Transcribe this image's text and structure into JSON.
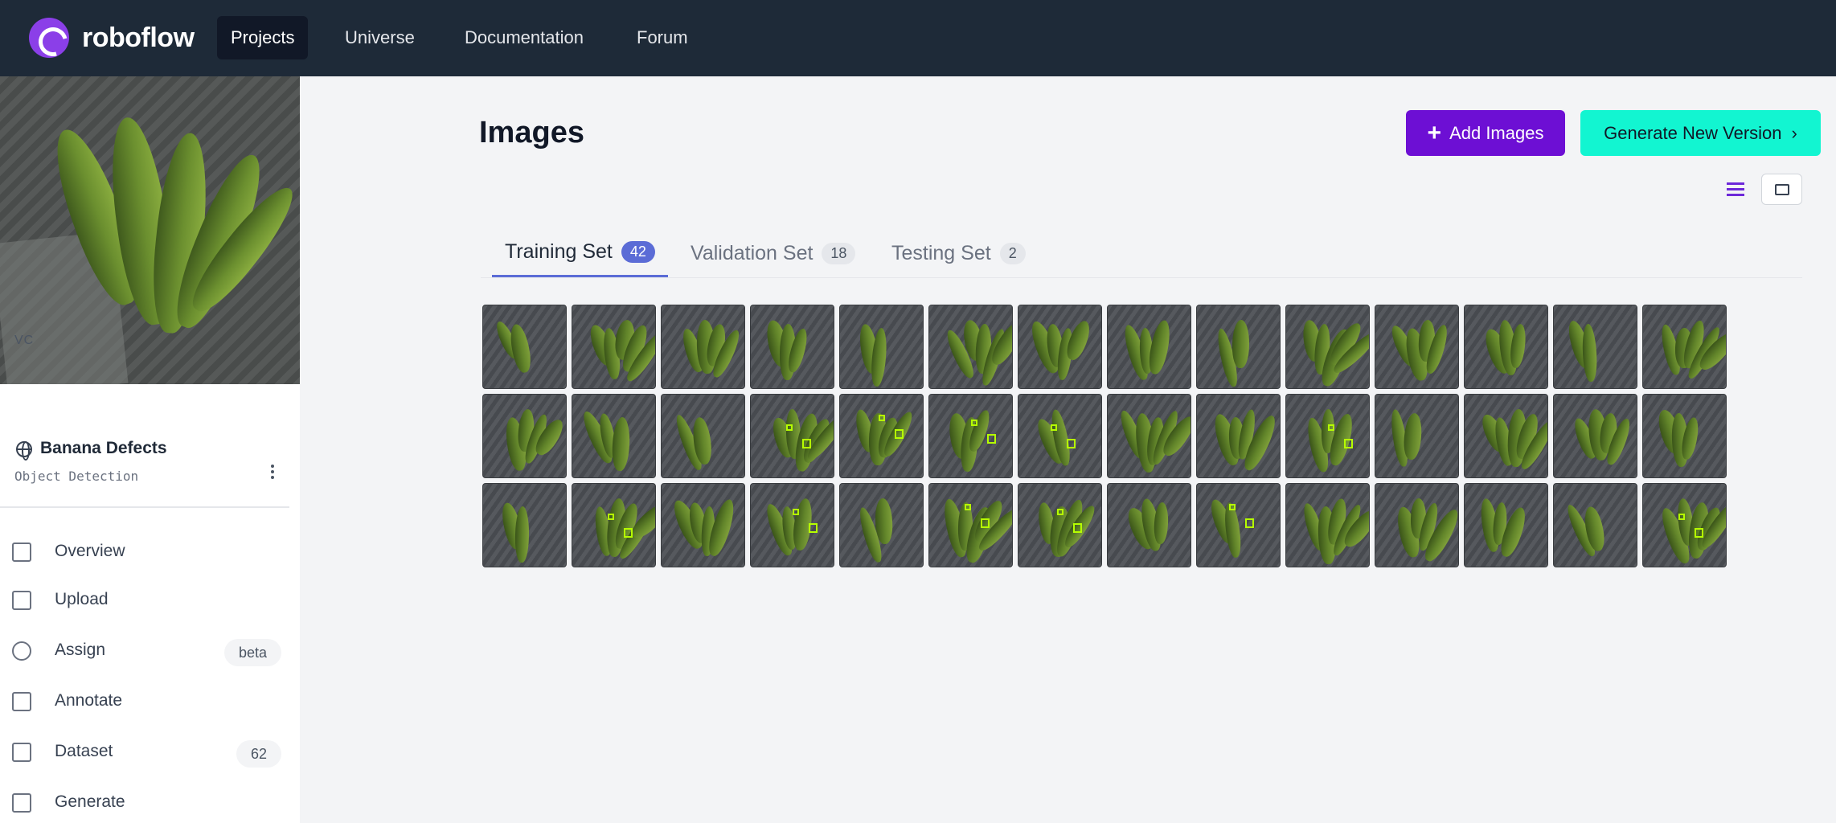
{
  "brand": {
    "name": "roboflow"
  },
  "nav": {
    "items": [
      {
        "label": "Projects",
        "active": true
      },
      {
        "label": "Universe",
        "active": false
      },
      {
        "label": "Documentation",
        "active": false
      },
      {
        "label": "Forum",
        "active": false
      }
    ]
  },
  "sidebar": {
    "workspace": "VC",
    "project_name": "Banana Defects",
    "project_type": "Object Detection",
    "items": [
      {
        "label": "Overview",
        "icon": "overview-icon"
      },
      {
        "label": "Upload",
        "icon": "upload-icon"
      },
      {
        "label": "Assign",
        "icon": "search-icon",
        "badge": "beta"
      },
      {
        "label": "Annotate",
        "icon": "annotate-icon"
      },
      {
        "label": "Dataset",
        "icon": "dataset-icon",
        "badge": "62"
      },
      {
        "label": "Generate",
        "icon": "generate-icon"
      }
    ]
  },
  "main": {
    "title": "Images",
    "add_images_label": "Add Images",
    "generate_label": "Generate New Version",
    "tabs": [
      {
        "label": "Training Set",
        "count": "42",
        "active": true
      },
      {
        "label": "Validation Set",
        "count": "18",
        "active": false
      },
      {
        "label": "Testing Set",
        "count": "2",
        "active": false
      }
    ],
    "image_count": 42,
    "annotated_thumbnails": [
      17,
      18,
      19,
      20,
      23,
      29,
      31,
      33,
      34,
      36,
      41
    ]
  },
  "colors": {
    "nav_bg": "#1e2a38",
    "add_button": "#6d0fd4",
    "generate_button": "#12f5d1",
    "tab_accent": "#5b6cd6",
    "annotation_box": "#b6ff00"
  }
}
